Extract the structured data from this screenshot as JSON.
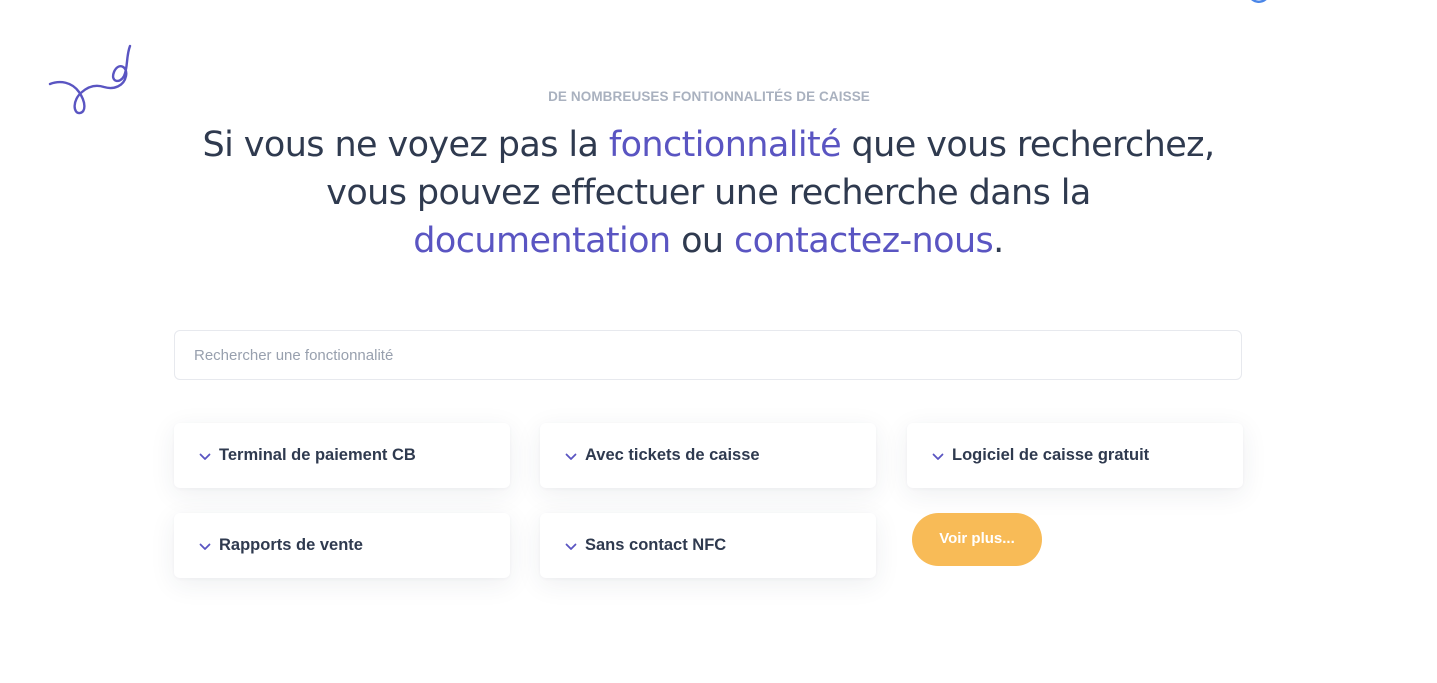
{
  "section": {
    "eyebrow": "DE NOMBREUSES FONTIONNALITÉS DE CAISSE",
    "headline": {
      "part1": "Si vous ne voyez pas la ",
      "highlight1": "fonctionnalité",
      "part2": " que vous recherchez, vous pouvez effectuer une recherche dans la ",
      "highlight2": "documentation",
      "part3": " ou ",
      "highlight3": "contactez-nous",
      "part4": "."
    },
    "accent_color": "#5a55c2"
  },
  "search": {
    "placeholder": "Rechercher une fonctionnalité",
    "value": ""
  },
  "features": [
    {
      "label": "Terminal de paiement CB",
      "icon": "chevron-down-icon"
    },
    {
      "label": "Avec tickets de caisse",
      "icon": "chevron-down-icon"
    },
    {
      "label": "Logiciel de caisse gratuit",
      "icon": "chevron-down-icon"
    },
    {
      "label": "Rapports de vente",
      "icon": "chevron-down-icon"
    },
    {
      "label": "Sans contact NFC",
      "icon": "chevron-down-icon"
    }
  ],
  "more_button": {
    "label": "Voir plus...",
    "color": "#f8bb57"
  },
  "decorations": {
    "squiggle_color": "#5a55c2",
    "corner_mark_color": "#4a86e8"
  }
}
